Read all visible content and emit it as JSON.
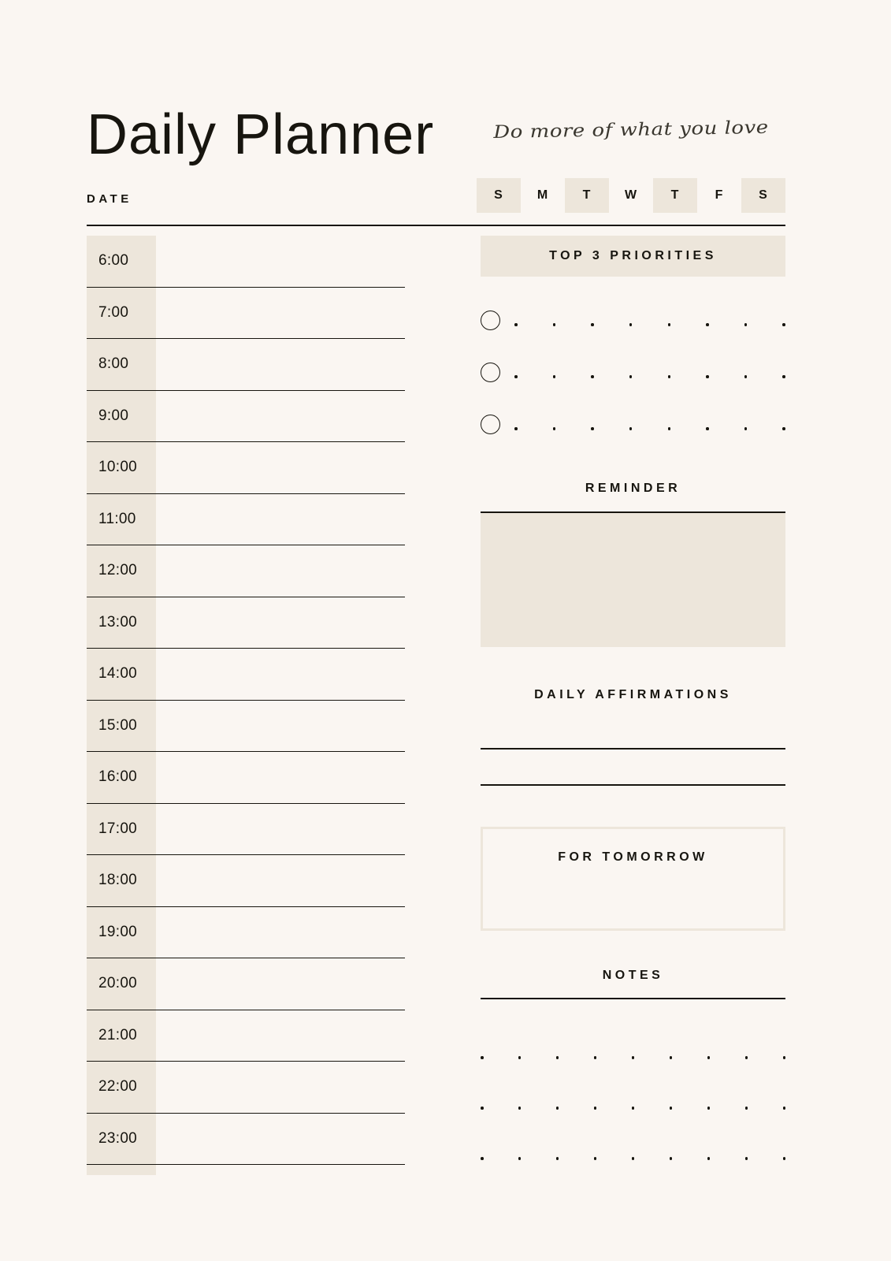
{
  "header": {
    "title": "Daily Planner",
    "tagline": "Do more of what you love",
    "date_label": "DATE",
    "days": [
      {
        "label": "S",
        "shaded": true
      },
      {
        "label": "M",
        "shaded": false
      },
      {
        "label": "T",
        "shaded": true
      },
      {
        "label": "W",
        "shaded": false
      },
      {
        "label": "T",
        "shaded": true
      },
      {
        "label": "F",
        "shaded": false
      },
      {
        "label": "S",
        "shaded": true
      }
    ]
  },
  "schedule": {
    "times": [
      "6:00",
      "7:00",
      "8:00",
      "9:00",
      "10:00",
      "11:00",
      "12:00",
      "13:00",
      "14:00",
      "15:00",
      "16:00",
      "17:00",
      "18:00",
      "19:00",
      "20:00",
      "21:00",
      "22:00",
      "23:00"
    ],
    "entries": [
      "",
      "",
      "",
      "",
      "",
      "",
      "",
      "",
      "",
      "",
      "",
      "",
      "",
      "",
      "",
      "",
      "",
      ""
    ]
  },
  "priorities": {
    "title": "TOP 3 PRIORITIES",
    "items": [
      {
        "checked": false,
        "text": ""
      },
      {
        "checked": false,
        "text": ""
      },
      {
        "checked": false,
        "text": ""
      }
    ],
    "dots_per_line": 8
  },
  "reminder": {
    "title": "REMINDER",
    "value": ""
  },
  "affirmations": {
    "title": "DAILY AFFIRMATIONS",
    "lines": [
      "",
      ""
    ]
  },
  "tomorrow": {
    "title": "FOR TOMORROW",
    "value": ""
  },
  "notes": {
    "title": "NOTES",
    "value": "",
    "dot_rows": 3,
    "dots_per_row": 9
  },
  "colors": {
    "page_background": "#FAF6F2",
    "beige_fill": "#EDE6DB",
    "ink": "#17150F"
  }
}
